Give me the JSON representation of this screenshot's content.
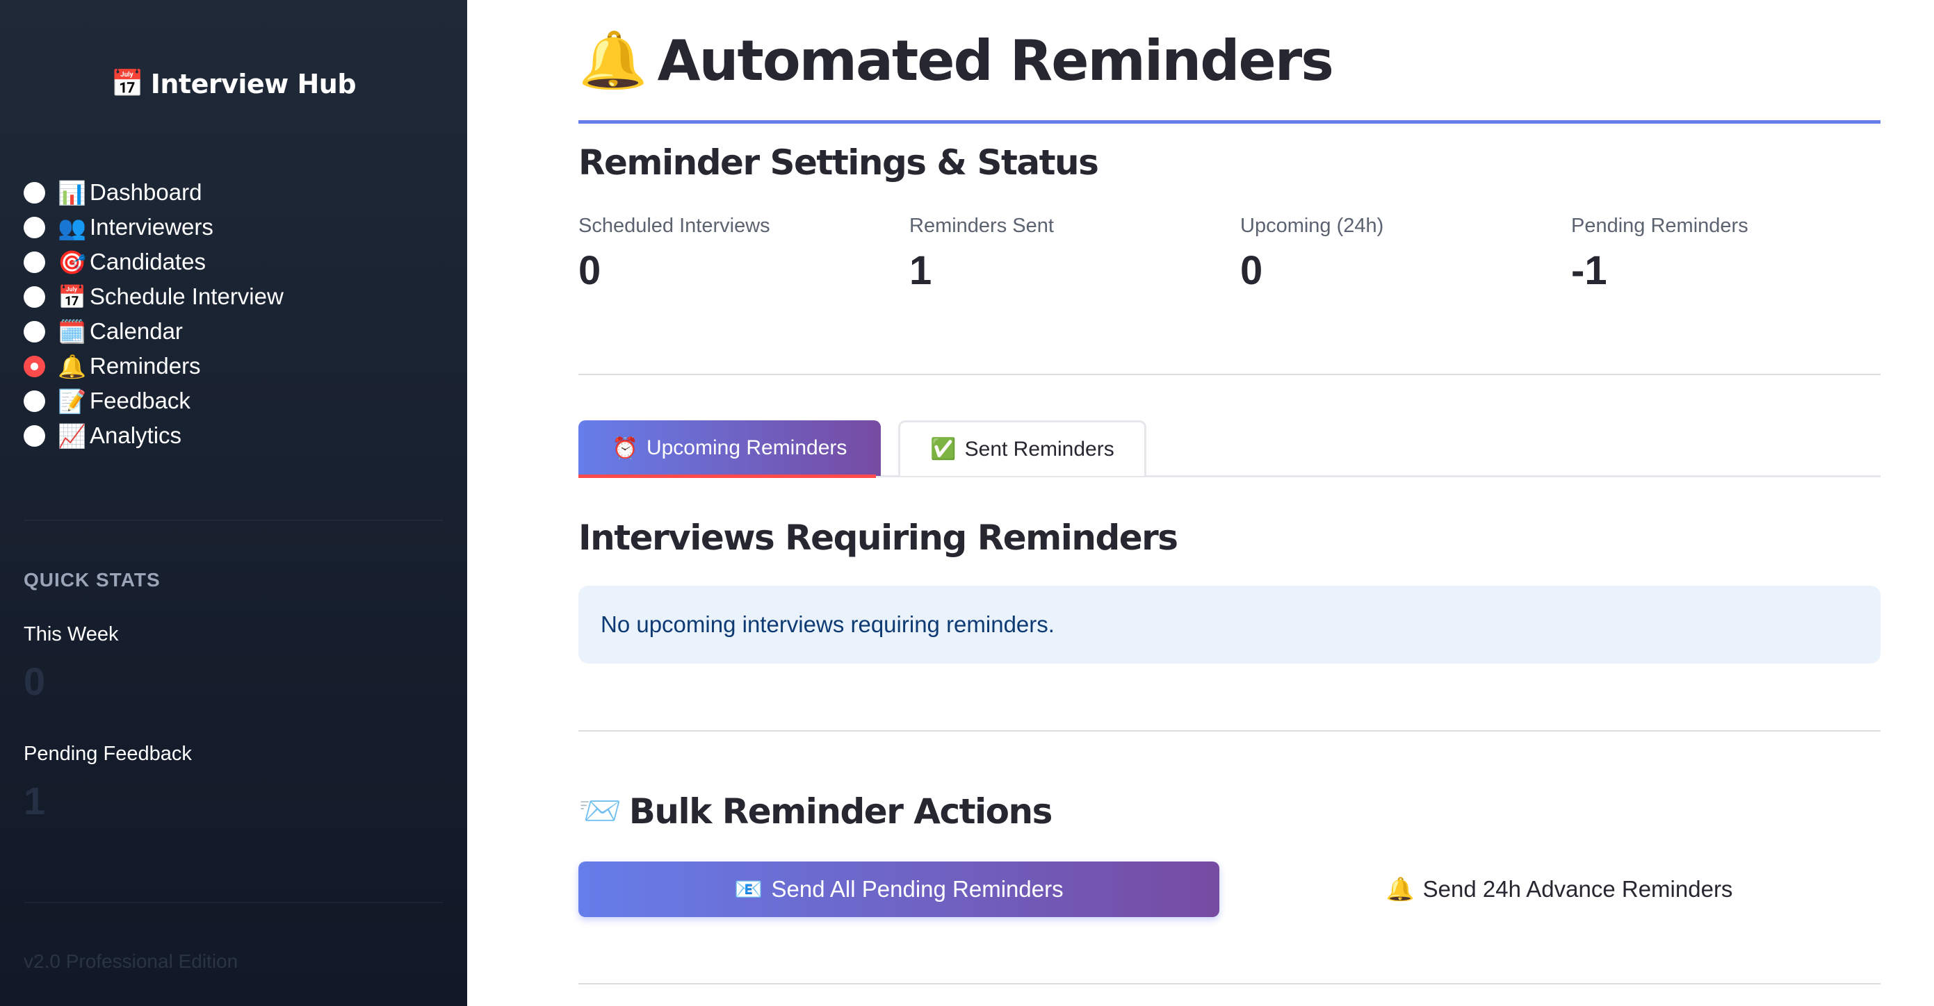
{
  "sidebar": {
    "brand_icon": "📅",
    "brand_title": "Interview Hub",
    "nav": [
      {
        "icon": "📊",
        "label": "Dashboard",
        "selected": false
      },
      {
        "icon": "👥",
        "label": "Interviewers",
        "selected": false
      },
      {
        "icon": "🎯",
        "label": "Candidates",
        "selected": false
      },
      {
        "icon": "📅",
        "label": "Schedule Interview",
        "selected": false
      },
      {
        "icon": "🗓️",
        "label": "Calendar",
        "selected": false
      },
      {
        "icon": "🔔",
        "label": "Reminders",
        "selected": true
      },
      {
        "icon": "📝",
        "label": "Feedback",
        "selected": false
      },
      {
        "icon": "📈",
        "label": "Analytics",
        "selected": false
      }
    ],
    "quick_stats_title": "QUICK STATS",
    "this_week_label": "This Week",
    "this_week_value": "0",
    "pending_feedback_label": "Pending Feedback",
    "pending_feedback_value": "1",
    "version": "v2.0 Professional Edition"
  },
  "main": {
    "title_icon": "🔔",
    "title": "Automated Reminders",
    "settings_title": "Reminder Settings & Status",
    "metrics": [
      {
        "label": "Scheduled Interviews",
        "value": "0"
      },
      {
        "label": "Reminders Sent",
        "value": "1"
      },
      {
        "label": "Upcoming (24h)",
        "value": "0"
      },
      {
        "label": "Pending Reminders",
        "value": "-1"
      }
    ],
    "tabs": [
      {
        "icon": "⏰",
        "label": "Upcoming Reminders",
        "active": true
      },
      {
        "icon": "✅",
        "label": "Sent Reminders",
        "active": false
      }
    ],
    "requiring_title": "Interviews Requiring Reminders",
    "info_message": "No upcoming interviews requiring reminders.",
    "bulk_icon": "📨",
    "bulk_title": "Bulk Reminder Actions",
    "send_all_icon": "📧",
    "send_all_label": "Send All Pending Reminders",
    "send_24h_icon": "🔔",
    "send_24h_label": "Send 24h Advance Reminders"
  },
  "colors": {
    "sidebar_top": "#1f2937",
    "sidebar_bottom": "#111827",
    "accent_start": "#667eea",
    "accent_end": "#764ba2",
    "selected_radio": "#ff4b4b",
    "info_bg": "#eaf2fb",
    "info_text": "#0e3a74"
  }
}
